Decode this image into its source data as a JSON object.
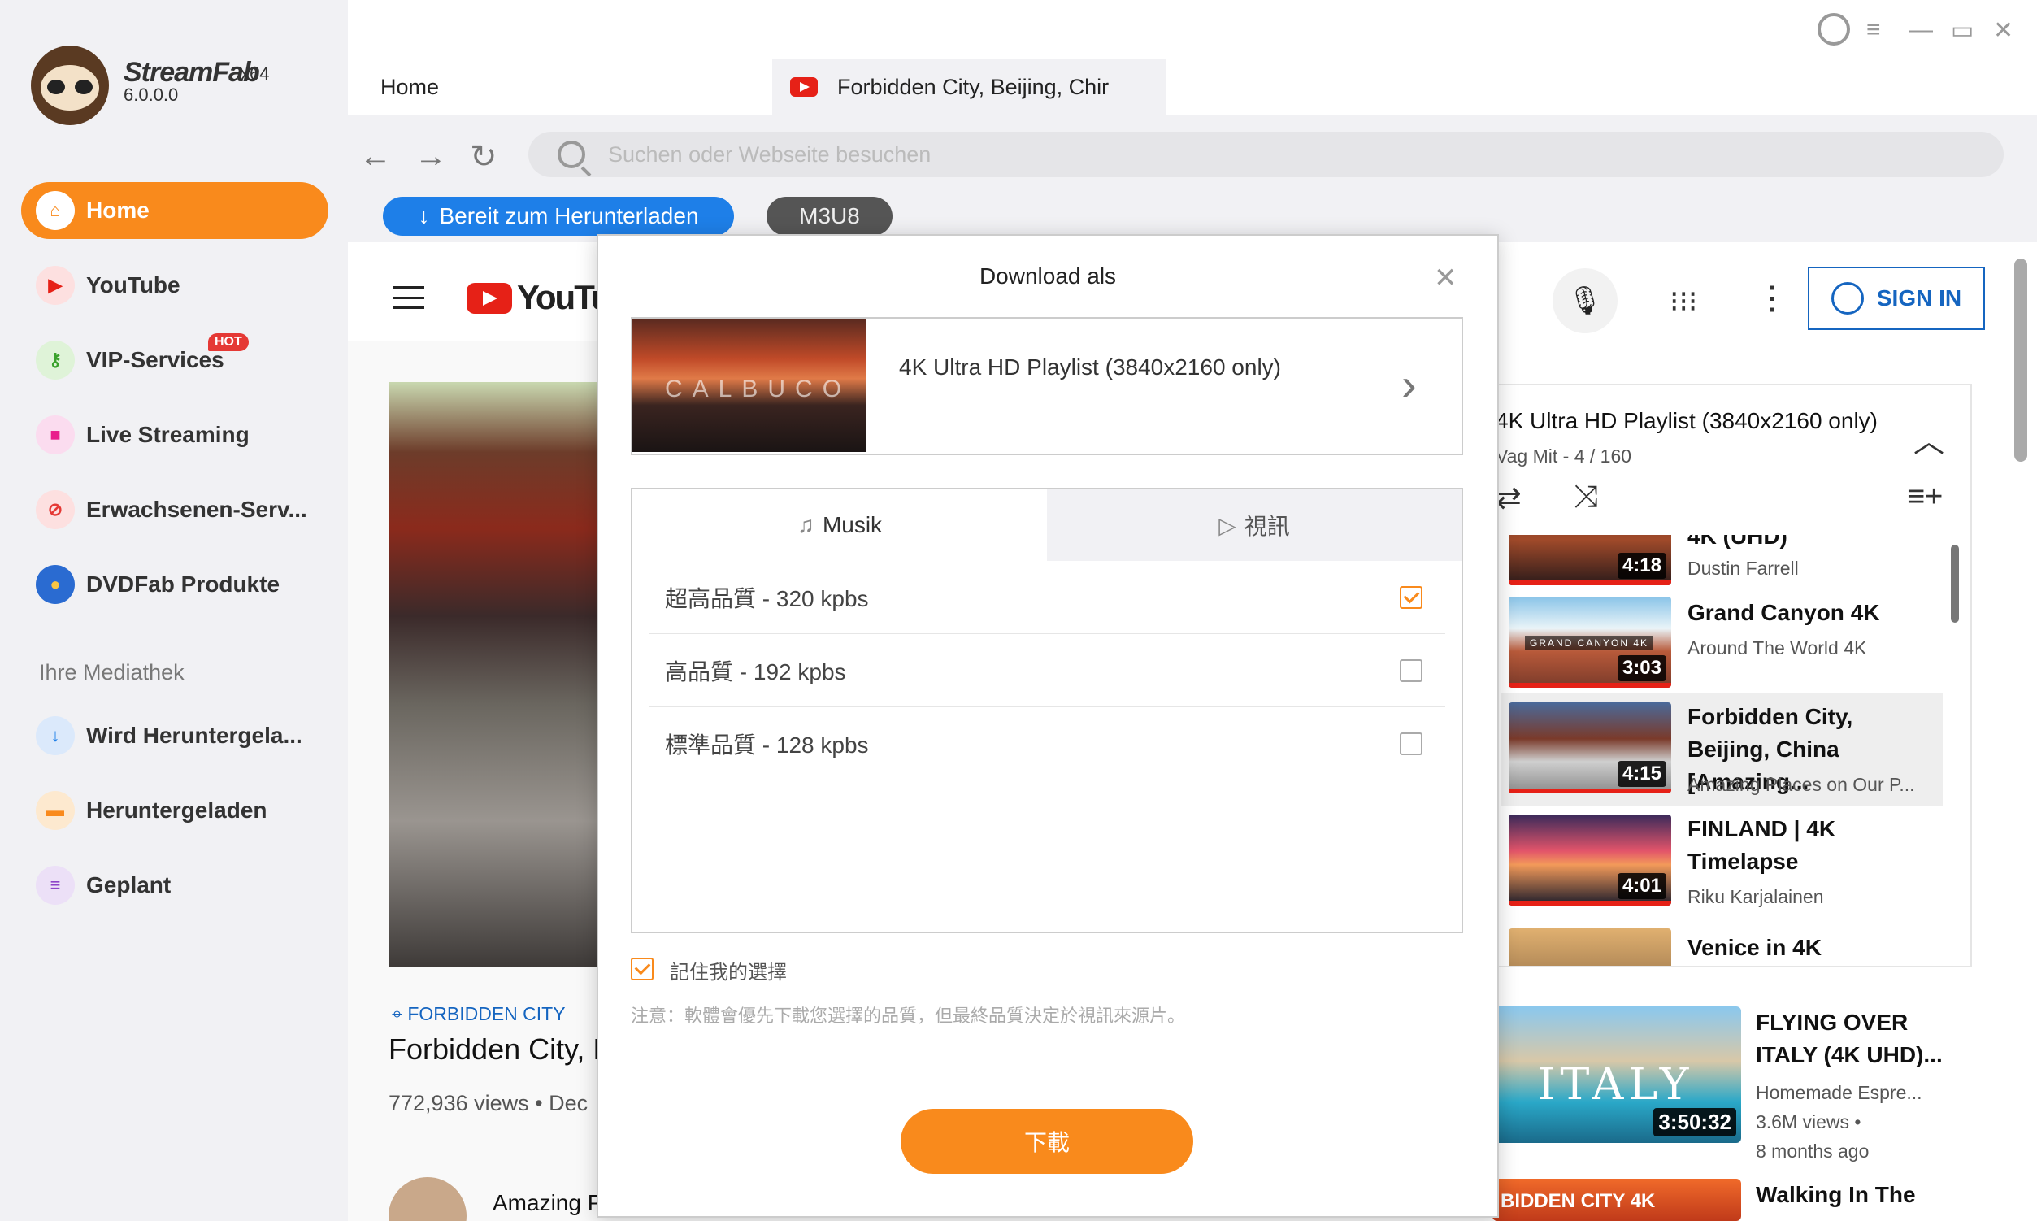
{
  "app": {
    "name": "StreamFab",
    "arch": "x64",
    "version": "6.0.0.0"
  },
  "sidebar": {
    "items": [
      {
        "label": "Home",
        "icon": "home-icon"
      },
      {
        "label": "YouTube",
        "icon": "youtube-icon"
      },
      {
        "label": "VIP-Services",
        "icon": "key-icon",
        "badge": "HOT"
      },
      {
        "label": "Live Streaming",
        "icon": "camera-icon"
      },
      {
        "label": "Erwachsenen-Serv...",
        "icon": "adult-icon"
      },
      {
        "label": "DVDFab Produkte",
        "icon": "dvdfab-icon"
      }
    ],
    "library_title": "Ihre Mediathek",
    "library": [
      {
        "label": "Wird Heruntergela...",
        "icon": "download-icon"
      },
      {
        "label": "Heruntergeladen",
        "icon": "folder-icon"
      },
      {
        "label": "Geplant",
        "icon": "schedule-icon"
      }
    ]
  },
  "tabs": [
    {
      "label": "Home"
    },
    {
      "label": "Forbidden City, Beijing, Chir"
    }
  ],
  "browser": {
    "search_placeholder": "Suchen oder Webseite besuchen",
    "ready_button": "Bereit zum Herunterladen",
    "m3u8_button": "M3U8"
  },
  "youtube": {
    "logo_text": "YouTube",
    "sign_in": "SIGN IN",
    "video": {
      "location": "FORBIDDEN CITY",
      "title": "Forbidden City, B",
      "meta": "772,936 views • Dec",
      "channel": "Amazing P"
    },
    "playlist": {
      "title": "4K Ultra HD Playlist (3840x2160 only)",
      "sub": "Vag Mit - 4 / 160",
      "items": [
        {
          "title": "4K (UHD)",
          "channel": "Dustin Farrell",
          "duration": "4:18"
        },
        {
          "title": "Grand Canyon 4K",
          "channel": "Around The World 4K",
          "duration": "3:03",
          "thumb_text": "GRAND CANYON 4K"
        },
        {
          "title": "Forbidden City, Beijing, China [Amazing...",
          "channel": "Amazing Places on Our P...",
          "duration": "4:15"
        },
        {
          "title": "FINLAND | 4K Timelapse",
          "channel": "Riku Karjalainen",
          "duration": "4:01"
        },
        {
          "title": "Venice in 4K",
          "channel": "",
          "duration": ""
        }
      ]
    },
    "recommended": [
      {
        "title": "FLYING OVER ITALY (4K UHD)...",
        "channel": "Homemade Espre...",
        "views": "3.6M views •",
        "age": "8 months ago",
        "duration": "3:50:32",
        "thumb_text": "ITALY"
      },
      {
        "title": "Walking In The",
        "thumb_text": "BIDDEN CITY 4K"
      }
    ]
  },
  "modal": {
    "title": "Download als",
    "source": "4K Ultra HD Playlist (3840x2160 only)",
    "source_thumb_text": "CALBUCO",
    "tabs": [
      "Musik",
      "視訊"
    ],
    "options": [
      {
        "label": "超高品質 - 320 kpbs",
        "checked": true
      },
      {
        "label": "高品質 - 192 kpbs",
        "checked": false
      },
      {
        "label": "標準品質 - 128 kpbs",
        "checked": false
      }
    ],
    "remember": "記住我的選擇",
    "note": "注意：軟體會優先下載您選擇的品質，但最終品質決定於視訊來源片。",
    "download": "下載"
  },
  "colors": {
    "accent": "#f98a1c",
    "blue": "#1e7fe8",
    "youtube_red": "#e62117"
  }
}
